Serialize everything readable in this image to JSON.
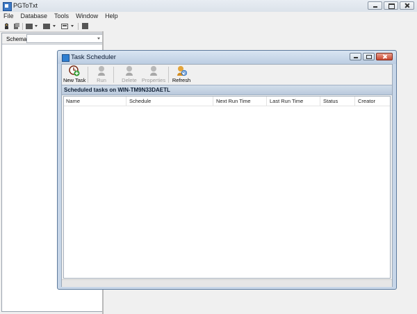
{
  "app": {
    "title": "PGToTxt"
  },
  "menu": [
    "File",
    "Database",
    "Tools",
    "Window",
    "Help"
  ],
  "schema": {
    "label": "Schema",
    "value": ""
  },
  "dialog": {
    "title": "Task Scheduler",
    "toolbar": [
      {
        "label": "New Task",
        "icon": "new-task-icon",
        "enabled": true
      },
      {
        "label": "Run",
        "icon": "run-icon",
        "enabled": false
      },
      {
        "label": "Delete",
        "icon": "delete-icon",
        "enabled": false
      },
      {
        "label": "Properties",
        "icon": "properties-icon",
        "enabled": false
      },
      {
        "label": "Refresh",
        "icon": "refresh-icon",
        "enabled": true
      }
    ],
    "section_title": "Scheduled tasks on WIN-TM9N33DAETL",
    "columns": [
      "Name",
      "Schedule",
      "Next Run Time",
      "Last Run Time",
      "Status",
      "Creator"
    ],
    "rows": []
  },
  "colors": {
    "accent": "#3c79c6",
    "dialog_frame": "#c7d6e8",
    "close_button": "#c9452e"
  }
}
